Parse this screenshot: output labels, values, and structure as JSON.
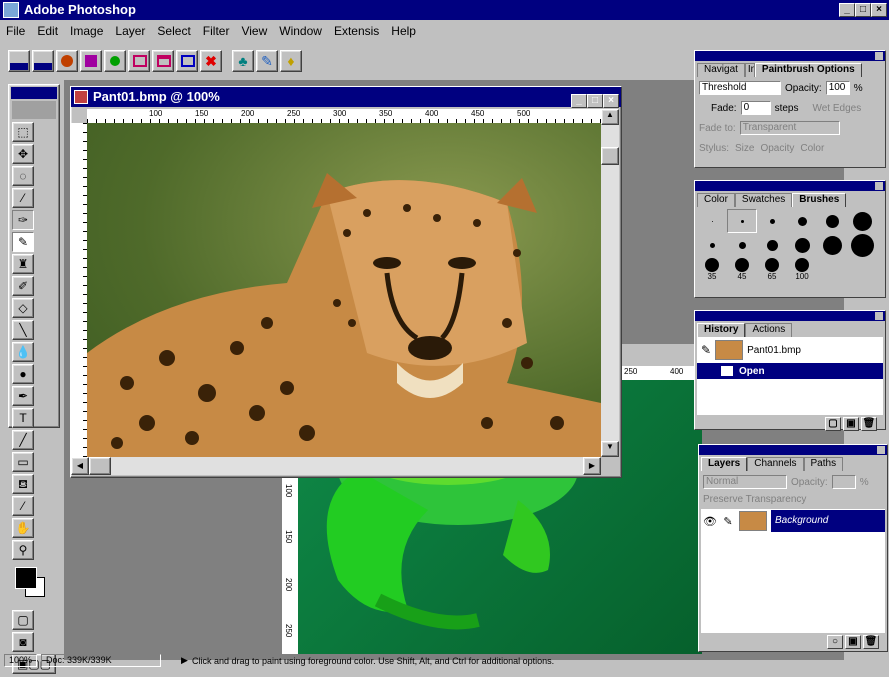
{
  "app": {
    "title": "Adobe Photoshop"
  },
  "menu": [
    "File",
    "Edit",
    "Image",
    "Layer",
    "Select",
    "Filter",
    "View",
    "Window",
    "Extensis",
    "Help"
  ],
  "cheetah_window": {
    "title": "Pant01.bmp @ 100%",
    "ruler_marks": [
      "100",
      "150",
      "200",
      "250",
      "300",
      "350",
      "400",
      "450",
      "500"
    ]
  },
  "frog_window": {
    "ruler_marks": [
      "250",
      "400"
    ],
    "v_marks": [
      "100",
      "150",
      "200",
      "250"
    ]
  },
  "paintbrush_panel": {
    "tabs": [
      "Navigat",
      "Info",
      "Paintbrush Options"
    ],
    "mode": "Threshold",
    "opacity_label": "Opacity:",
    "opacity_value": "100",
    "opacity_unit": "%",
    "fade_label": "Fade:",
    "fade_value": "0",
    "fade_unit": "steps",
    "wet_edges": "Wet Edges",
    "fade_to_label": "Fade to:",
    "fade_to_value": "Transparent",
    "stylus_label": "Stylus:",
    "stylus_opts": [
      "Size",
      "Opacity",
      "Color"
    ]
  },
  "brushes_panel": {
    "tabs": [
      "Color",
      "Swatches",
      "Brushes"
    ],
    "sizes": [
      "35",
      "45",
      "65",
      "100"
    ]
  },
  "history_panel": {
    "tabs": [
      "History",
      "Actions"
    ],
    "snapshot": "Pant01.bmp",
    "state": "Open"
  },
  "layers_panel": {
    "tabs": [
      "Layers",
      "Channels",
      "Paths"
    ],
    "mode": "Normal",
    "opacity_label": "Opacity:",
    "opacity_unit": "%",
    "preserve": "Preserve Transparency",
    "layer_name": "Background"
  },
  "status": {
    "zoom": "100%",
    "doc": "Doc: 339K/339K",
    "hint": "Click and drag to paint using foreground color.  Use Shift, Alt, and Ctrl for additional options."
  },
  "colors": {
    "titlebar": "#000080",
    "face": "#c0c0c0",
    "frog_bg": "#0a7a3a"
  }
}
